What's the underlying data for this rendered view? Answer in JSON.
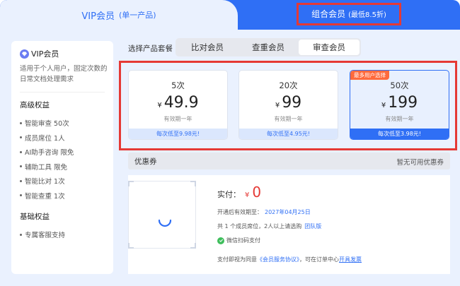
{
  "tabs": {
    "vip_label": "VIP会员",
    "vip_sub": "(单一产品)",
    "combo_label": "组合会员",
    "combo_sub": "(最低8.5折)"
  },
  "sidebar": {
    "title": "VIP会员",
    "desc": "适用于个人用户，固定次数的日常文档处理需求",
    "advanced_title": "高级权益",
    "advanced_items": [
      "智能审查 50次",
      "成员席位 1人",
      "AI助手咨询 限免",
      "辅助工具 限免",
      "智能比对 1次",
      "智能查重 1次"
    ],
    "basic_title": "基础权益",
    "basic_items": [
      "专属客服支持"
    ]
  },
  "selector": {
    "label": "选择产品套餐",
    "options": [
      "比对会员",
      "查重会员",
      "审查会员"
    ],
    "selected": "审查会员"
  },
  "plans": [
    {
      "count": "5次",
      "currency": "¥",
      "price": "49.9",
      "validity": "有效期一年",
      "per_use": "每次低至9.98元!",
      "badge": ""
    },
    {
      "count": "20次",
      "currency": "¥",
      "price": "99",
      "validity": "有效期一年",
      "per_use": "每次低至4.95元!",
      "badge": ""
    },
    {
      "count": "50次",
      "currency": "¥",
      "price": "199",
      "validity": "有效期一年",
      "per_use": "每次低至3.98元!",
      "badge": "最多用户选择"
    }
  ],
  "coupon": {
    "label": "优惠券",
    "status": "暂无可用优惠券"
  },
  "payment": {
    "amount_label": "实付：",
    "currency": "¥",
    "amount": "0",
    "expiry_prefix": "开通后有效期至：",
    "expiry_date": "2027年04月25日",
    "seats_text": "共 1 个成员席位，2人以上请选购",
    "team_link": "团队版",
    "method": "微信扫码支付",
    "agree_prefix": "支付即视为同意",
    "agreement_link": "《会员服务协议》",
    "agree_mid": "，可在订单中心",
    "invoice_link": "开具发票"
  },
  "colors": {
    "accent": "#2f6ff5",
    "highlight_red": "#e53935",
    "badge_orange": "#ff6a3d",
    "wechat_green": "#3fbe5c"
  }
}
